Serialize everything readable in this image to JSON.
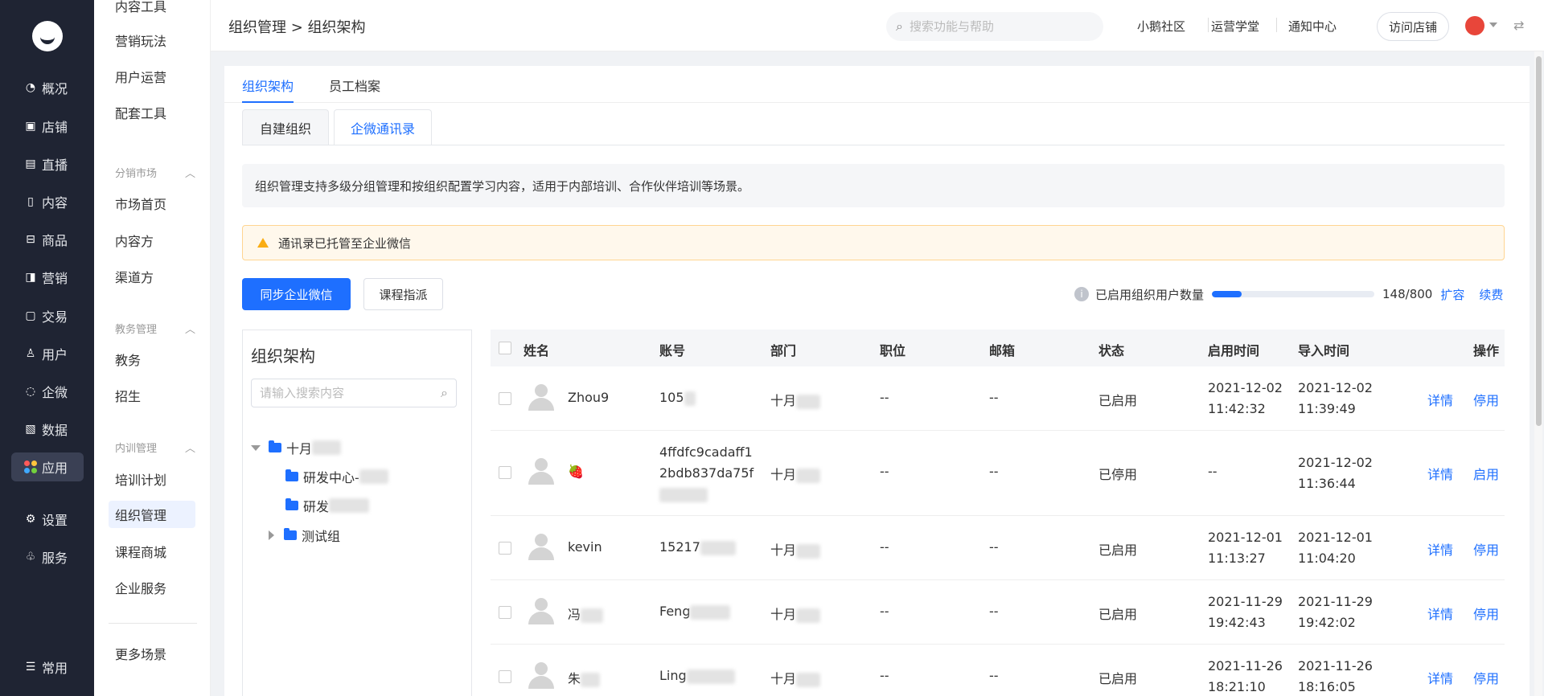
{
  "nav": {
    "items": [
      {
        "label": "概况",
        "icon": "pie-chart-icon"
      },
      {
        "label": "店铺",
        "icon": "store-icon"
      },
      {
        "label": "直播",
        "icon": "live-icon"
      },
      {
        "label": "内容",
        "icon": "document-icon"
      },
      {
        "label": "商品",
        "icon": "goods-icon"
      },
      {
        "label": "营销",
        "icon": "megaphone-icon"
      },
      {
        "label": "交易",
        "icon": "trade-icon"
      },
      {
        "label": "用户",
        "icon": "user-icon"
      },
      {
        "label": "企微",
        "icon": "wecom-icon"
      },
      {
        "label": "数据",
        "icon": "data-icon"
      },
      {
        "label": "应用",
        "icon": "apps-icon"
      },
      {
        "label": "设置",
        "icon": "gear-icon"
      },
      {
        "label": "服务",
        "icon": "service-icon"
      },
      {
        "label": "常用",
        "icon": "list-icon"
      }
    ]
  },
  "sub": {
    "top_cut": "内容工具",
    "items_a": [
      "营销玩法",
      "用户运营",
      "配套工具"
    ],
    "group_distribution": "分销市场",
    "items_b": [
      "市场首页",
      "内容方",
      "渠道方"
    ],
    "group_edu": "教务管理",
    "items_c": [
      "教务",
      "招生"
    ],
    "group_training": "内训管理",
    "items_d": [
      "培训计划",
      "组织管理",
      "课程商城",
      "企业服务"
    ],
    "more": "更多场景"
  },
  "header": {
    "breadcrumb": "组织管理 > 组织架构",
    "search_placeholder": "搜索功能与帮助",
    "links": [
      "小鹅社区",
      "运营学堂",
      "通知中心"
    ],
    "visit_store": "访问店铺"
  },
  "tabs": [
    "组织架构",
    "员工档案"
  ],
  "seg_tabs": [
    "自建组织",
    "企微通讯录"
  ],
  "info_text": "组织管理支持多级分组管理和按组织配置学习内容，适用于内部培训、合作伙伴培训等场景。",
  "warn_text": "通讯录已托管至企业微信",
  "buttons": {
    "sync": "同步企业微信",
    "assign": "课程指派"
  },
  "quota": {
    "label": "已启用组织用户数量",
    "used": 148,
    "total": 800,
    "text": "148/800",
    "expand": "扩容",
    "renew": "续费"
  },
  "tree": {
    "title": "组织架构",
    "search_placeholder": "请输入搜索内容",
    "nodes": [
      "十月",
      "研发中心-",
      "研发",
      "测试组"
    ]
  },
  "table": {
    "headers": [
      "姓名",
      "账号",
      "部门",
      "职位",
      "邮箱",
      "状态",
      "启用时间",
      "导入时间",
      "操作"
    ],
    "rows": [
      {
        "name": "Zhou9",
        "account": "105",
        "dept": "十月",
        "position": "--",
        "email": "--",
        "status": "已启用",
        "enabled_date": "2021-12-02",
        "enabled_time": "11:42:32",
        "import_date": "2021-12-02",
        "import_time": "11:39:49",
        "detail": "详情",
        "action": "停用"
      },
      {
        "name": "🍓",
        "account": "4ffdfc9cadaff1",
        "account2": "2bdb837da75f",
        "dept": "十月",
        "position": "--",
        "email": "--",
        "status": "已停用",
        "enabled_date": "--",
        "enabled_time": "",
        "import_date": "2021-12-02",
        "import_time": "11:36:44",
        "detail": "详情",
        "action": "启用"
      },
      {
        "name": "kevin",
        "account": "15217",
        "dept": "十月",
        "position": "--",
        "email": "--",
        "status": "已启用",
        "enabled_date": "2021-12-01",
        "enabled_time": "11:13:27",
        "import_date": "2021-12-01",
        "import_time": "11:04:20",
        "detail": "详情",
        "action": "停用"
      },
      {
        "name": "冯",
        "account": "Feng",
        "dept": "十月",
        "position": "--",
        "email": "--",
        "status": "已启用",
        "enabled_date": "2021-11-29",
        "enabled_time": "19:42:43",
        "import_date": "2021-11-29",
        "import_time": "19:42:02",
        "detail": "详情",
        "action": "停用"
      },
      {
        "name": "朱",
        "account": "Ling",
        "dept": "十月",
        "position": "--",
        "email": "--",
        "status": "已启用",
        "enabled_date": "2021-11-26",
        "enabled_time": "18:21:10",
        "import_date": "2021-11-26",
        "import_time": "18:16:05",
        "detail": "详情",
        "action": "停用"
      }
    ]
  },
  "colors": {
    "primary": "#1e6fff",
    "nav_bg": "#1f2433",
    "warn": "#faad14"
  }
}
